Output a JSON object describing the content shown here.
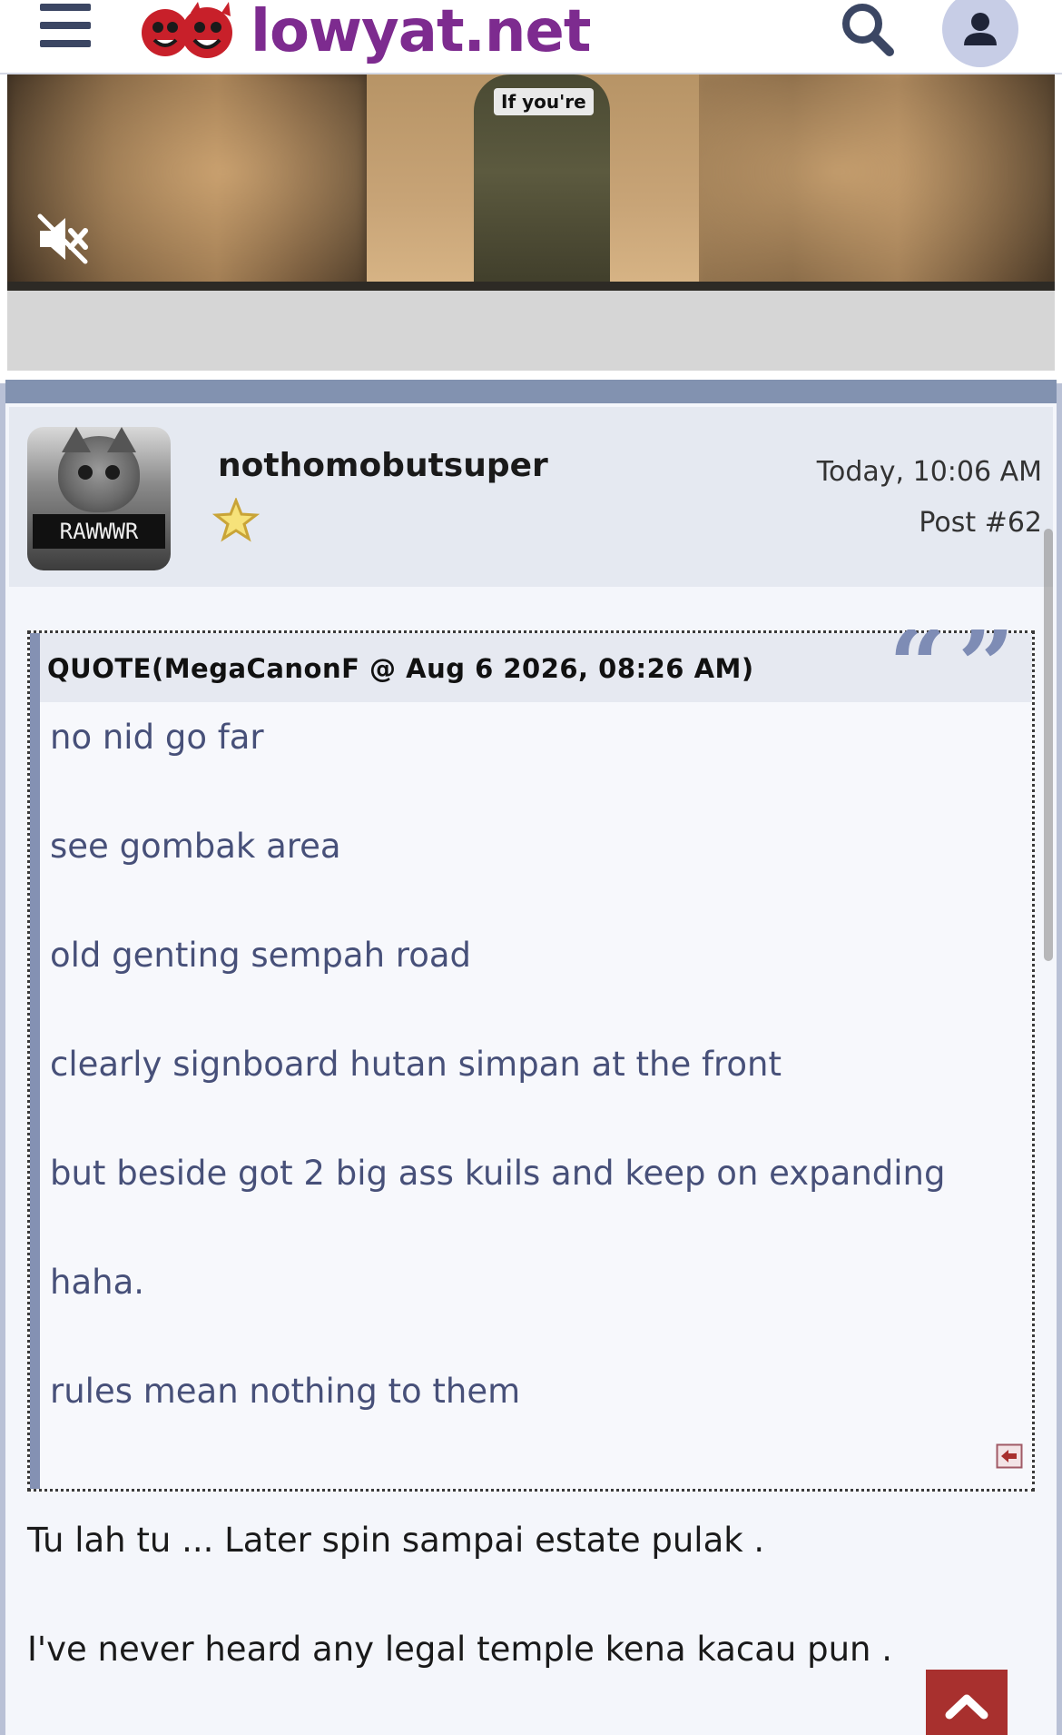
{
  "header": {
    "logo_text": "lowyat.net",
    "icons": {
      "menu": "hamburger-menu-icon",
      "search": "search-icon",
      "account": "user-icon"
    }
  },
  "video": {
    "caption": "If you're",
    "mute_icon": "mute-icon"
  },
  "post": {
    "username": "nothomobutsuper",
    "avatar_label": "RAWWWR",
    "rank_icon": "star-icon",
    "timestamp": "Today, 10:06 AM",
    "post_number": "Post #62",
    "quote": {
      "title": "QUOTE(MegaCanonF @ Aug 6 2026, 08:26 AM)",
      "lines": [
        "no nid go far",
        "see gombak area",
        "old genting sempah road",
        "clearly signboard hutan simpan at the front",
        "but beside got 2 big ass kuils and keep on expanding",
        "haha.",
        "rules mean nothing to them"
      ]
    },
    "reply_lines": [
      "Tu lah tu ... Later spin sampai estate pulak .",
      "I've never heard any legal temple kena kacau pun ."
    ]
  },
  "colors": {
    "brand": "#7d2b8f",
    "header_icon": "#3b4663",
    "quote_text": "#475079",
    "quote_bar": "#8491b3",
    "scroll_top_button": "#a8302e"
  }
}
